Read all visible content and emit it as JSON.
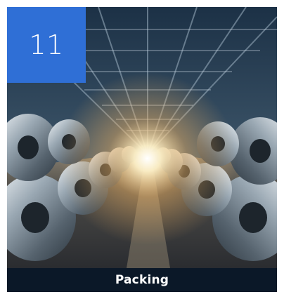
{
  "card": {
    "step_number": "11",
    "title": "Packing",
    "image_subject": "warehouse-steel-coils-image"
  },
  "colors": {
    "badge_background": "#2f6fd6",
    "caption_background": "#0b1828",
    "text": "#ffffff"
  }
}
